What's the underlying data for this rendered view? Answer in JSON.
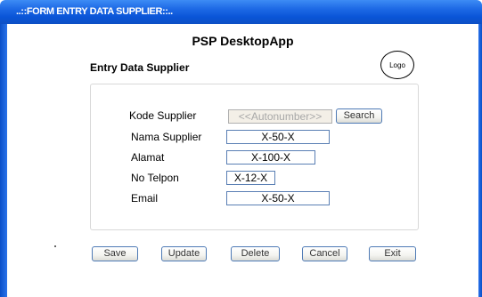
{
  "window": {
    "title": "..::FORM ENTRY DATA SUPPLIER::.."
  },
  "app": {
    "title": "PSP DesktopApp"
  },
  "form": {
    "title": "Entry Data Supplier",
    "logo_label": "Logo"
  },
  "fields": {
    "kode_supplier": {
      "label": "Kode Supplier",
      "value": "<<Autonumber>>"
    },
    "nama_supplier": {
      "label": "Nama Supplier",
      "value": "X-50-X"
    },
    "alamat": {
      "label": "Alamat",
      "value": "X-100-X"
    },
    "no_telpon": {
      "label": "No Telpon",
      "value": "X-12-X"
    },
    "email": {
      "label": "Email",
      "value": "X-50-X"
    }
  },
  "buttons": {
    "search": "Search",
    "save": "Save",
    "update": "Update",
    "delete": "Delete",
    "cancel": "Cancel",
    "exit": "Exit"
  }
}
